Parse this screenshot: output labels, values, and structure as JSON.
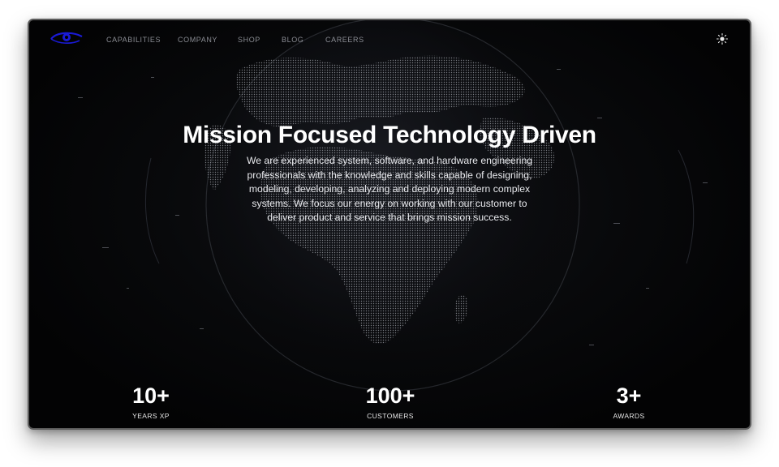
{
  "nav": {
    "items": [
      {
        "label": "CAPABILITIES"
      },
      {
        "label": "COMPANY"
      },
      {
        "label": "SHOP"
      },
      {
        "label": "BLOG"
      },
      {
        "label": "CAREERS"
      }
    ],
    "theme_icon": "sun-icon",
    "logo_icon": "eye-logo-icon"
  },
  "hero": {
    "title": "Mission Focused Technology Driven",
    "body": "We are experienced system, software, and hardware engineering professionals with the knowledge and skills capable of designing, modeling, developing, analyzing and deploying modern complex systems. We focus our energy on working with our customer to deliver product and service that brings mission success."
  },
  "stats": [
    {
      "value": "10+",
      "label": "YEARS XP"
    },
    {
      "value": "100+",
      "label": "CUSTOMERS"
    },
    {
      "value": "3+",
      "label": "AWARDS"
    }
  ],
  "colors": {
    "background": "#060708",
    "text": "#ffffff",
    "nav_text": "#8a8c93",
    "logo": "#1a1ad6"
  }
}
